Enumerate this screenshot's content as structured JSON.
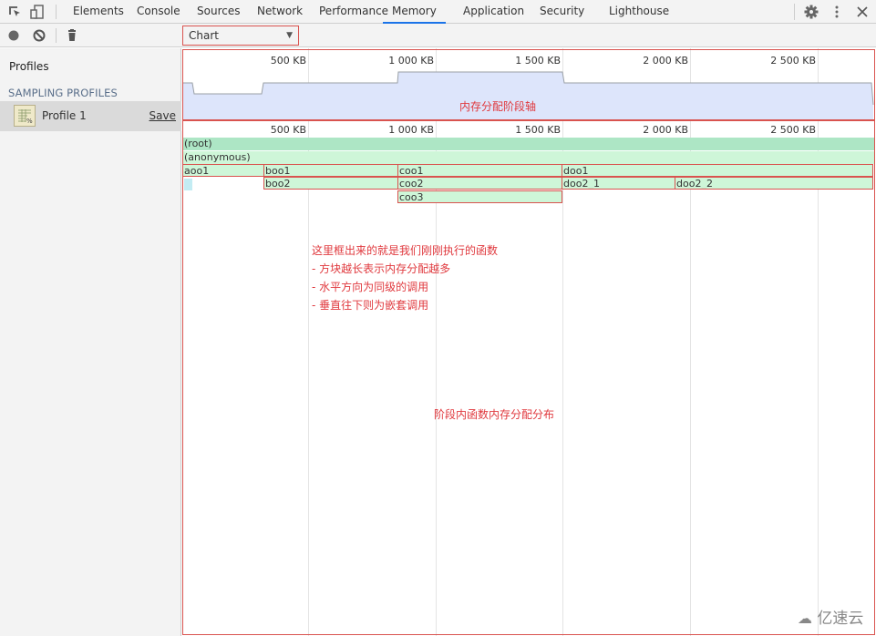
{
  "tabbar": {
    "tabs": [
      {
        "label": "Elements",
        "active": false
      },
      {
        "label": "Console",
        "active": false
      },
      {
        "label": "Sources",
        "active": false
      },
      {
        "label": "Network",
        "active": false
      },
      {
        "label": "Performance",
        "active": false
      },
      {
        "label": "Memory",
        "active": true
      },
      {
        "label": "Application",
        "active": false
      },
      {
        "label": "Security",
        "active": false
      },
      {
        "label": "Lighthouse",
        "active": false
      }
    ],
    "icons": [
      "inspect-element-icon",
      "device-toolbar-icon",
      "settings-gear-icon",
      "more-vertical-icon",
      "close-icon"
    ],
    "accent_color": "#1a73e8"
  },
  "toolbar": {
    "view_select": {
      "value": "Chart"
    },
    "icons": [
      "record-icon",
      "clear-icon",
      "delete-icon"
    ]
  },
  "sidebar": {
    "profiles_label": "Profiles",
    "section_title": "SAMPLING PROFILES",
    "items": [
      {
        "name": "Profile 1",
        "save_label": "Save",
        "selected": true
      }
    ]
  },
  "overview": {
    "ticks": [
      "500 KB",
      "1 000 KB",
      "1 500 KB",
      "2 000 KB",
      "2 500 KB"
    ],
    "annotation": "内存分配阶段轴"
  },
  "flamechart": {
    "ticks": [
      "500 KB",
      "1 000 KB",
      "1 500 KB",
      "2 000 KB",
      "2 500 KB"
    ],
    "frames": [
      {
        "label": "(root)",
        "kind": "root"
      },
      {
        "label": "(anonymous)",
        "kind": "anon"
      },
      {
        "label": "aoo1",
        "kind": "fn"
      },
      {
        "label": "boo1",
        "kind": "fn"
      },
      {
        "label": "coo1",
        "kind": "fn"
      },
      {
        "label": "doo1",
        "kind": "fn"
      },
      {
        "label": "boo2",
        "kind": "fn"
      },
      {
        "label": "coo2",
        "kind": "fn"
      },
      {
        "label": "doo2_1",
        "kind": "fn"
      },
      {
        "label": "doo2_2",
        "kind": "fn"
      },
      {
        "label": "coo3",
        "kind": "fn"
      }
    ],
    "notes": [
      "这里框出来的就是我们刚刚执行的函数",
      "- 方块越长表示内存分配越多",
      "- 水平方向为同级的调用",
      "- 垂直往下则为嵌套调用"
    ],
    "distribution_label": "阶段内函数内存分配分布",
    "annotation_color": "#e0393e",
    "frame_color": "#cef6d8",
    "root_color": "#ade6c5"
  },
  "watermark": "亿速云"
}
